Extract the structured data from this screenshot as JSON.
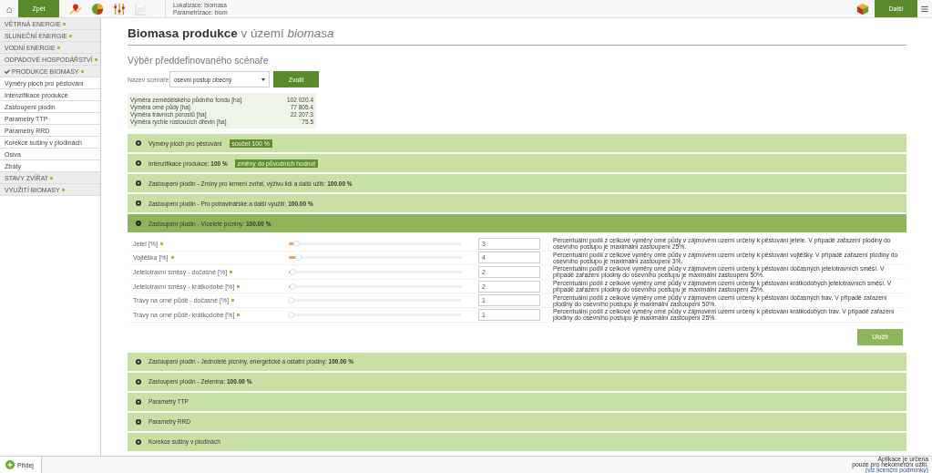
{
  "topbar": {
    "home": "⌂",
    "back_button": "Zpět",
    "tools": [
      {
        "kind": "route",
        "disabled": false
      },
      {
        "kind": "pie",
        "disabled": false
      },
      {
        "kind": "sliders",
        "disabled": false
      },
      {
        "kind": "chart",
        "disabled": true
      }
    ],
    "location_lines": [
      "Lokalizace: biomasa",
      "Parametrizace: biom"
    ],
    "next_button": "Další"
  },
  "sidebar": {
    "items": [
      {
        "label": "VĚTRNÁ ENERGIE",
        "kind": "group",
        "checked": false
      },
      {
        "label": "SLUNEČNÍ ENERGIE",
        "kind": "group",
        "checked": false
      },
      {
        "label": "VODNÍ ENERGIE",
        "kind": "group",
        "checked": false
      },
      {
        "label": "ODPADOVÉ HOSPODÁŘSTVÍ",
        "kind": "group",
        "checked": false
      },
      {
        "label": "PRODUKCE BIOMASY",
        "kind": "group",
        "checked": true
      },
      {
        "label": "Výměry ploch pro pěstování",
        "kind": "item",
        "checked": false
      },
      {
        "label": "Intenzifikace produkce",
        "kind": "item",
        "checked": false
      },
      {
        "label": "Zastoupení plodin",
        "kind": "item",
        "checked": false
      },
      {
        "label": "Parametry TTP",
        "kind": "item",
        "checked": false
      },
      {
        "label": "Parametry RRD",
        "kind": "item",
        "checked": false
      },
      {
        "label": "Korekce sušiny v plodinách",
        "kind": "item",
        "checked": false
      },
      {
        "label": "Osiva",
        "kind": "item",
        "checked": false
      },
      {
        "label": "Ztráty",
        "kind": "item",
        "checked": false
      },
      {
        "label": "STAVY ZVÍŘAT",
        "kind": "group",
        "checked": false
      },
      {
        "label": "VYUŽITÍ BIOMASY",
        "kind": "group",
        "checked": false
      }
    ]
  },
  "page": {
    "title": "Biomasa produkce",
    "title_rest": "v území",
    "title_place": "biomasa",
    "subtitle": "Výběr předdefinovaného scénaře",
    "scenario_label": "Název scénáře:",
    "scenario_value": "osevní postup obecný",
    "choose_button": "Zvolit",
    "summary": [
      {
        "label": "Výměra zemědělského půdního fondu [ha]",
        "value": "102 020.4"
      },
      {
        "label": "Výměra orné půdy [ha]",
        "value": "77 805.4"
      },
      {
        "label": "Výměra travních porostů [ha]",
        "value": "22 207.3"
      },
      {
        "label": "Výměra rychle rostoucích dřevin [ha]",
        "value": "75.5"
      }
    ],
    "sections": [
      {
        "title": "Výměry ploch pro pěstování",
        "badge": "součet 100 %",
        "expanded": false
      },
      {
        "title": "Intenzifikace produkce: ",
        "value": "100 %",
        "badge": "změny do původních hodnot",
        "expanded": false
      },
      {
        "title": "Zastoupení plodin - Zrniny pro krmení zvířat, výživu lidí a další užití: ",
        "value": "100.00 %",
        "expanded": false
      },
      {
        "title": "Zastoupení plodin - Pro potravinářské a další využití: ",
        "value": "100.00 %",
        "expanded": false
      },
      {
        "title": "Zastoupení plodin - Víceleté pícniny: ",
        "value": "100.00 %",
        "expanded": true,
        "save_button": "Uložit",
        "fields": [
          {
            "label": "Jetel [%]",
            "level": 0.03,
            "value": "3",
            "description": "Percentuální podíl z celkové výměry orné půdy v zájmovém území určený k pěstování jetele. V případě zařazení plodiny do osevního postupu je maximální zastoupení 25%."
          },
          {
            "label": "Vojtěška [%]",
            "level": 0.04,
            "value": "4",
            "description": "Percentuální podíl z celkové výměry orné půdy v zájmovém území určený k pěstování vojtěšky. V případě zařazení plodiny do osevního postupu je maximální zastoupení 3%."
          },
          {
            "label": "Jetelotravní směsy - dočasné [%]",
            "level": 0.01,
            "value": "2",
            "description": "Percentuální podíl z celkové výměry orné půdy v zájmovém území určený k pěstování dočasných jetelotravních směsí. V případě zařazení plodiny do osevního postupu je maximální zastoupení 50%."
          },
          {
            "label": "Jetelotravní směsy - krátkodobé [%]",
            "level": 0.01,
            "value": "2",
            "description": "Percentuální podíl z celkové výměry orné půdy v zájmovém území určený k pěstování krátkodobých jetelotravních směsí. V případě zařazení plodiny do osevního postupu je maximální zastoupení 25%."
          },
          {
            "label": "Trávy na orné půdě - dočasné [%]",
            "level": 0,
            "value": "1",
            "description": "Percentuální podíl z celkové výměry orné půdy v zájmovém území určený k pěstování dočasných trav. V případě zařazení plodiny do osevního postupu je maximální zastoupení 50%."
          },
          {
            "label": "Trávy na orné půdě- krátkodobé [%]",
            "level": 0,
            "value": "1",
            "description": "Percentuální podíl z celkové výměry orné půdy v zájmovém území určený k pěstování krátkodobých trav. V případě zařazení plodiny do osevního postupu je maximální zastoupení 25%."
          }
        ]
      },
      {
        "title": "Zastoupení plodin - Jednoleté pícniny, energetické a ostatní plodiny: ",
        "value": "100.00 %",
        "expanded": false
      },
      {
        "title": "Zastoupení plodin - Zelenina: ",
        "value": "100.00 %",
        "expanded": false
      },
      {
        "title": "Parametry TTP",
        "expanded": false
      },
      {
        "title": "Parametry RRD",
        "expanded": false
      },
      {
        "title": "Korekce sušiny v plodinách",
        "expanded": false
      }
    ]
  },
  "bottombar": {
    "add_button": "Přidej",
    "notice_lines": [
      "Aplikace je určena",
      "pouze pro nekomerční užití."
    ],
    "license_link": "(viz licenční podmínky)"
  }
}
